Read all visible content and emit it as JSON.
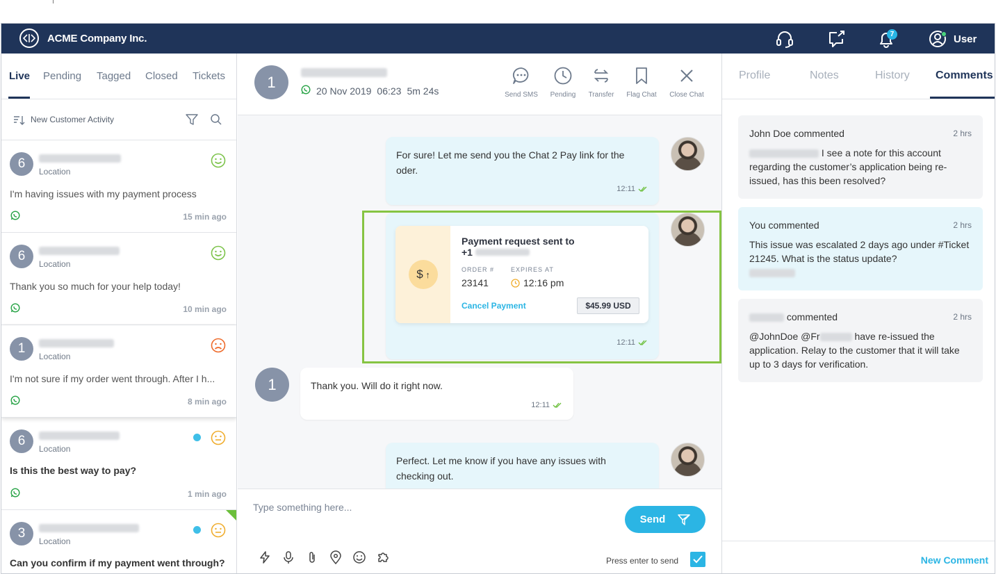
{
  "app": {
    "company": "ACME Company Inc.",
    "notifications_count": "7",
    "user_label": "User"
  },
  "left": {
    "tabs": [
      "Live",
      "Pending",
      "Tagged",
      "Closed",
      "Tickets"
    ],
    "filter_label": "New Customer Activity",
    "conversations": [
      {
        "avatar": "6",
        "location": "Location",
        "message": "I'm having issues with my payment process",
        "ago": "15 min ago",
        "mood": "happy"
      },
      {
        "avatar": "6",
        "location": "Location",
        "message": "Thank you so much for your help today!",
        "ago": "10 min ago",
        "mood": "happy"
      },
      {
        "avatar": "1",
        "location": "Location",
        "message": "I'm not sure if my order went through. After I h...",
        "ago": "8 min ago",
        "mood": "sad"
      },
      {
        "avatar": "6",
        "location": "Location",
        "message": "Is this the best way to pay?",
        "ago": "1 min ago",
        "mood": "neutral"
      },
      {
        "avatar": "3",
        "location": "Location",
        "message": "Can you confirm if my payment went through?",
        "ago": "",
        "mood": "neutral"
      }
    ]
  },
  "chat": {
    "avatar": "1",
    "date": "20 Nov 2019",
    "time": "06:23",
    "duration": "5m 24s",
    "actions": [
      "Send SMS",
      "Pending",
      "Transfer",
      "Flag Chat",
      "Close Chat"
    ],
    "messages": [
      {
        "text": "For sure! Let me send you the Chat 2 Pay link for the oder.",
        "time": "12:11"
      },
      {
        "time": "12:11"
      },
      {
        "text": "Thank you. Will do it right now.",
        "time": "12:11"
      },
      {
        "text": "Perfect. Let me know if you have any issues with checking out."
      }
    ],
    "payment": {
      "title": "Payment request sent to",
      "phone_prefix": "+1",
      "order_label": "ORDER #",
      "order_value": "23141",
      "expires_label": "EXPIRES AT",
      "expires_value": "12:16 pm",
      "cancel_label": "Cancel Payment",
      "amount": "$45.99 USD",
      "icon_text": "$"
    },
    "composer": {
      "placeholder": "Type something here...",
      "send_label": "Send",
      "enter_label": "Press enter to send"
    }
  },
  "right": {
    "tabs": [
      "Profile",
      "Notes",
      "History",
      "Comments"
    ],
    "comments": [
      {
        "author": "John Doe",
        "verb": "commented",
        "time": "2 hrs",
        "text": "I see a note for this account regarding the customer’s application being re-issued, has this been resolved?"
      },
      {
        "author": "You",
        "verb": "commented",
        "time": "2 hrs",
        "text": "This issue was escalated 2 days ago under #Ticket 21245. What is the status update?"
      },
      {
        "author": "",
        "verb": "commented",
        "time": "2 hrs",
        "mention_a": "@JohnDoe",
        "mention_b": "@Fr",
        "text": "have re-issued the application. Relay to the customer that it will take up to 3 days for verification."
      }
    ],
    "new_comment": "New Comment"
  },
  "colors": {
    "navy": "#1f3459",
    "accent": "#2bb5e4",
    "highlight": "#86c442",
    "bubble_out": "#e6f6fb"
  }
}
